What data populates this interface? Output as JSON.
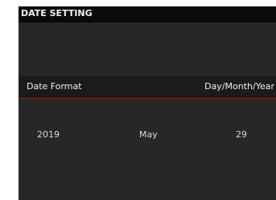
{
  "header": {
    "title": "DATE SETTING"
  },
  "menu_row": {
    "label": "Date Format",
    "value": "Day/Month/Year"
  },
  "date": {
    "year": "2019",
    "month": "May",
    "day": "29"
  },
  "colors": {
    "screen_bg": "#272727",
    "title_bar": "#0a0a0a",
    "accent_line": "#7a2020"
  }
}
